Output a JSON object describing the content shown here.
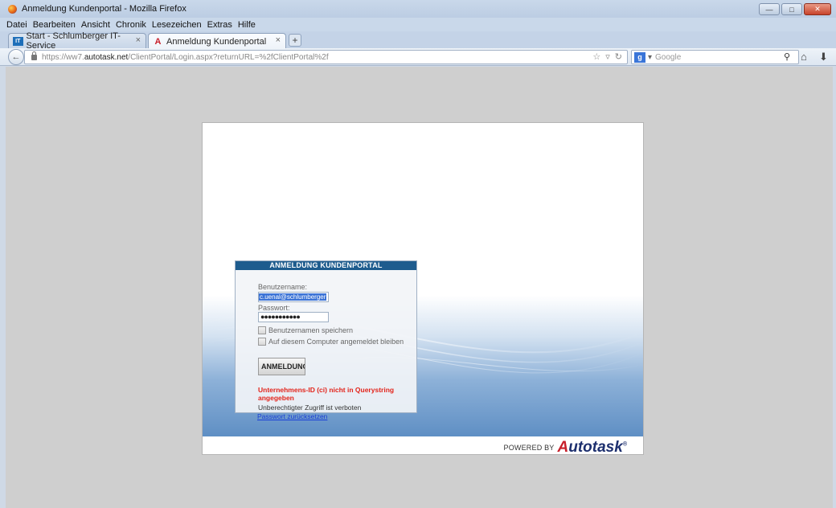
{
  "window": {
    "title": "Anmeldung Kundenportal - Mozilla Firefox"
  },
  "menu": {
    "items": [
      "Datei",
      "Bearbeiten",
      "Ansicht",
      "Chronik",
      "Lesezeichen",
      "Extras",
      "Hilfe"
    ]
  },
  "tabs": [
    {
      "label": "Start - Schlumberger IT-Service",
      "favicon": "it-favicon"
    },
    {
      "label": "Anmeldung Kundenportal",
      "favicon": "autotask-favicon"
    }
  ],
  "nav": {
    "url_prefix": "https://ww7.",
    "url_domain": "autotask.net",
    "url_rest": "/ClientPortal/Login.aspx?returnURL=%2fClientPortal%2f",
    "search_placeholder": "Google"
  },
  "login": {
    "header": "ANMELDUNG KUNDENPORTAL",
    "username_label": "Benutzername:",
    "username_value": "c.uenal@schlumberger",
    "password_label": "Passwort:",
    "password_value": "●●●●●●●●●●●",
    "remember_user": "Benutzernamen speichern",
    "stay_logged_in": "Auf diesem Computer angemeldet bleiben",
    "submit_label": "ANMELDUNG",
    "error_message": "Unternehmens-ID (ci) nicht in Querystring angegeben",
    "warning_message": "Unberechtigter Zugriff ist verboten",
    "reset_link": "Passwort zurücksetzen"
  },
  "footer": {
    "powered_by": "POWERED BY",
    "brand_a": "A",
    "brand_rest": "utotask",
    "tm": "®"
  },
  "colors": {
    "login_header": "#1e5c8e",
    "error_text": "#e3231a",
    "link": "#1a3fd6",
    "brand_navy": "#1d2f6e",
    "brand_red": "#c8202b"
  }
}
